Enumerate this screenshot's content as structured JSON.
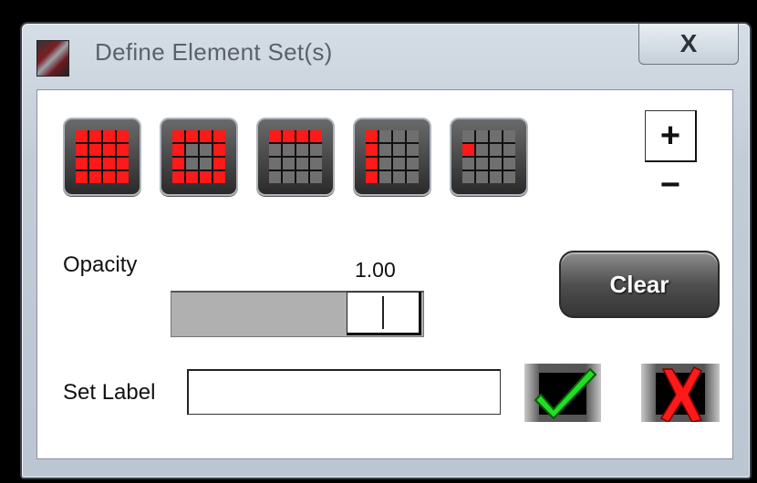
{
  "window": {
    "title": "Define Element Set(s)",
    "close_label": "X"
  },
  "toolbar": {
    "grid_buttons": [
      {
        "name": "grid-all-icon",
        "pattern": [
          1,
          1,
          1,
          1,
          1,
          1,
          1,
          1,
          1,
          1,
          1,
          1,
          1,
          1,
          1,
          1
        ]
      },
      {
        "name": "grid-border-icon",
        "pattern": [
          1,
          1,
          1,
          1,
          1,
          0,
          0,
          1,
          1,
          0,
          0,
          1,
          1,
          1,
          1,
          1
        ]
      },
      {
        "name": "grid-top-row-icon",
        "pattern": [
          1,
          1,
          1,
          1,
          0,
          0,
          0,
          0,
          0,
          0,
          0,
          0,
          0,
          0,
          0,
          0
        ]
      },
      {
        "name": "grid-left-column-icon",
        "pattern": [
          1,
          0,
          0,
          0,
          1,
          0,
          0,
          0,
          1,
          0,
          0,
          0,
          1,
          0,
          0,
          0
        ]
      },
      {
        "name": "grid-single-cell-icon",
        "pattern": [
          0,
          0,
          0,
          0,
          1,
          0,
          0,
          0,
          0,
          0,
          0,
          0,
          0,
          0,
          0,
          0
        ]
      }
    ],
    "plus_label": "+",
    "minus_label": "−"
  },
  "opacity": {
    "label": "Opacity",
    "value_text": "1.00",
    "value": 1.0
  },
  "clear_label": "Clear",
  "set_label": {
    "label": "Set Label",
    "value": ""
  },
  "colors": {
    "selected_cell": "#ff1a1a",
    "unselected_cell": "#6f6f6f",
    "confirm_check": "#22dd22",
    "cancel_x": "#ff1a1a"
  }
}
